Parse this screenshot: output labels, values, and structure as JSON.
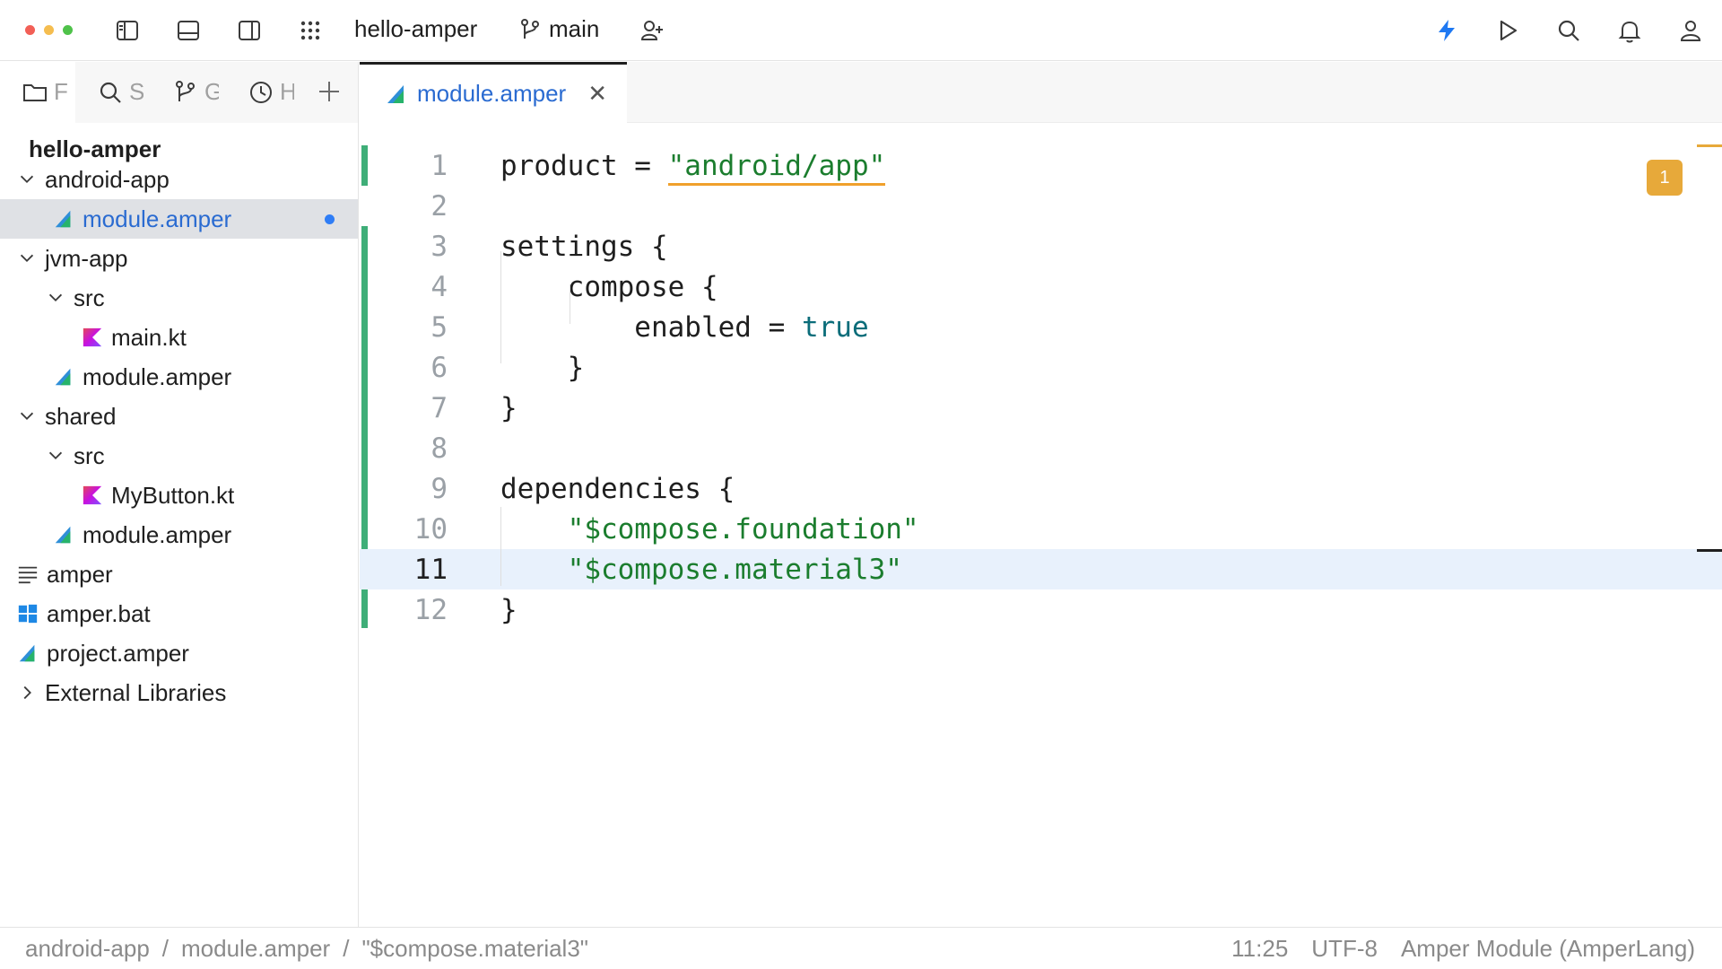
{
  "window": {
    "project_name": "hello-amper",
    "branch": "main",
    "traffic_colors": [
      "#f25f56",
      "#f5bd4f",
      "#4fc24a"
    ],
    "accent_color": "#1e78f2"
  },
  "tool_tabs": [
    {
      "icon": "folder-icon",
      "label": "F"
    },
    {
      "icon": "search-icon",
      "label": "S"
    },
    {
      "icon": "git-branch-icon",
      "label": "G"
    },
    {
      "icon": "clock-icon",
      "label": "H"
    },
    {
      "icon": "plus-icon",
      "label": ""
    }
  ],
  "project_tree": {
    "root": "hello-amper",
    "items": [
      {
        "label": "android-app",
        "kind": "folder",
        "expanded": true
      },
      {
        "label": "module.amper",
        "kind": "amper",
        "selected": true,
        "modified": true
      },
      {
        "label": "jvm-app",
        "kind": "folder",
        "expanded": true
      },
      {
        "label": "src",
        "kind": "folder",
        "expanded": true
      },
      {
        "label": "main.kt",
        "kind": "kotlin"
      },
      {
        "label": "module.amper",
        "kind": "amper"
      },
      {
        "label": "shared",
        "kind": "folder",
        "expanded": true
      },
      {
        "label": "src",
        "kind": "folder",
        "expanded": true
      },
      {
        "label": "MyButton.kt",
        "kind": "kotlin"
      },
      {
        "label": "module.amper",
        "kind": "amper"
      },
      {
        "label": "amper",
        "kind": "text"
      },
      {
        "label": "amper.bat",
        "kind": "windows"
      },
      {
        "label": "project.amper",
        "kind": "amper"
      },
      {
        "label": "External Libraries",
        "kind": "folder",
        "expanded": false
      }
    ]
  },
  "editor": {
    "tab_label": "module.amper",
    "warning_count": "1",
    "lines": [
      {
        "n": "1",
        "text": "product = \"android/app\""
      },
      {
        "n": "2",
        "text": ""
      },
      {
        "n": "3",
        "text": "settings {"
      },
      {
        "n": "4",
        "text": "    compose {"
      },
      {
        "n": "5",
        "text": "        enabled = true"
      },
      {
        "n": "6",
        "text": "    }"
      },
      {
        "n": "7",
        "text": "}"
      },
      {
        "n": "8",
        "text": ""
      },
      {
        "n": "9",
        "text": "dependencies {"
      },
      {
        "n": "10",
        "text": "    \"$compose.foundation\""
      },
      {
        "n": "11",
        "text": "    \"$compose.material3\""
      },
      {
        "n": "12",
        "text": "}"
      }
    ],
    "current_line": "11"
  },
  "status_bar": {
    "breadcrumbs": [
      "android-app",
      "module.amper",
      "\"$compose.material3\""
    ],
    "separator": "/",
    "position": "11:25",
    "encoding": "UTF-8",
    "file_type": "Amper Module (AmperLang)"
  }
}
